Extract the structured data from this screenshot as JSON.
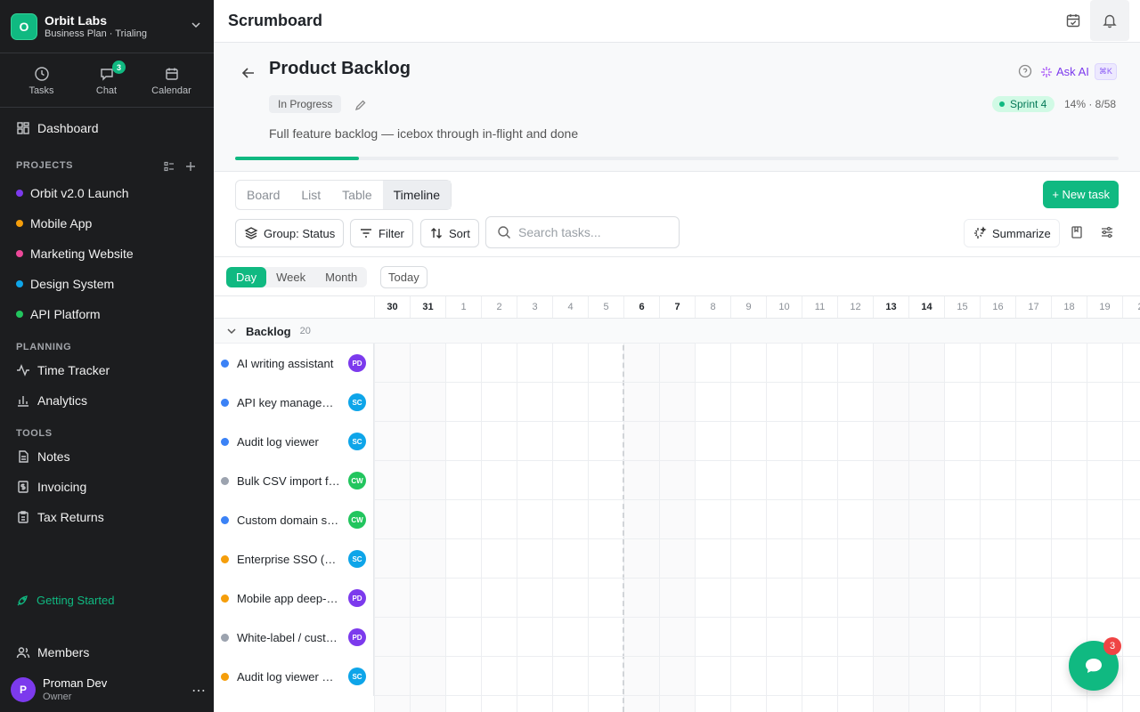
{
  "org": {
    "initial": "O",
    "name": "Orbit Labs",
    "plan": "Business Plan · Trialing"
  },
  "quick": [
    {
      "label": "Tasks",
      "icon": "clock-icon"
    },
    {
      "label": "Chat",
      "icon": "chat-icon",
      "badge": "3"
    },
    {
      "label": "Calendar",
      "icon": "calendar-icon"
    }
  ],
  "nav": {
    "dashboard": "Dashboard"
  },
  "projects": {
    "heading": "PROJECTS",
    "items": [
      {
        "label": "Orbit v2.0 Launch",
        "color": "#7c3aed"
      },
      {
        "label": "Mobile App",
        "color": "#f59e0b"
      },
      {
        "label": "Marketing Website",
        "color": "#ec4899"
      },
      {
        "label": "Design System",
        "color": "#0ea5e9"
      },
      {
        "label": "API Platform",
        "color": "#22c55e"
      }
    ]
  },
  "planning": {
    "heading": "PLANNING",
    "items": [
      "Time Tracker",
      "Analytics"
    ]
  },
  "tools": {
    "heading": "TOOLS",
    "items": [
      "Notes",
      "Invoicing",
      "Tax Returns"
    ]
  },
  "getting_started": "Getting Started",
  "members": "Members",
  "user": {
    "initial": "P",
    "name": "Proman Dev",
    "role": "Owner"
  },
  "topbar": {
    "title": "Scrumboard"
  },
  "header": {
    "title": "Product Backlog",
    "status": "In Progress",
    "description": "Full feature backlog — icebox through in-flight and done",
    "ask_ai": "Ask AI",
    "shortcut": "⌘K",
    "sprint": "Sprint 4",
    "progress_text": "14% · 8/58",
    "progress_fraction": 0.14
  },
  "views": {
    "tabs": [
      "Board",
      "List",
      "Table",
      "Timeline"
    ],
    "active": "Timeline"
  },
  "new_task": "+ New task",
  "toolbar": {
    "group": "Group: Status",
    "filter": "Filter",
    "sort": "Sort",
    "search_placeholder": "Search tasks...",
    "summarize": "Summarize"
  },
  "timeline": {
    "scales": [
      "Day",
      "Week",
      "Month"
    ],
    "active_scale": "Day",
    "today": "Today",
    "dates": [
      "30",
      "31",
      "1",
      "2",
      "3",
      "4",
      "5",
      "6",
      "7",
      "8",
      "9",
      "10",
      "11",
      "12",
      "13",
      "14",
      "15",
      "16",
      "17",
      "18",
      "19",
      "2"
    ],
    "bold_dates": [
      "30",
      "31",
      "6",
      "7",
      "13",
      "14"
    ],
    "group": {
      "label": "Backlog",
      "count": "20"
    },
    "tasks": [
      {
        "name": "AI writing assistant",
        "dot": "#3b82f6",
        "assignee": "PD",
        "avatar": "#7c3aed"
      },
      {
        "name": "API key management",
        "dot": "#3b82f6",
        "assignee": "SC",
        "avatar": "#0ea5e9"
      },
      {
        "name": "Audit log viewer",
        "dot": "#3b82f6",
        "assignee": "SC",
        "avatar": "#0ea5e9"
      },
      {
        "name": "Bulk CSV import flow",
        "dot": "#9ca3af",
        "assignee": "CW",
        "avatar": "#22c55e"
      },
      {
        "name": "Custom domain support",
        "dot": "#3b82f6",
        "assignee": "CW",
        "avatar": "#22c55e"
      },
      {
        "name": "Enterprise SSO (SAML)",
        "dot": "#f59e0b",
        "assignee": "SC",
        "avatar": "#0ea5e9"
      },
      {
        "name": "Mobile app deep-linking",
        "dot": "#f59e0b",
        "assignee": "PD",
        "avatar": "#7c3aed"
      },
      {
        "name": "White-label / custom branding",
        "dot": "#9ca3af",
        "assignee": "PD",
        "avatar": "#7c3aed"
      },
      {
        "name": "Audit log viewer with filters",
        "dot": "#f59e0b",
        "assignee": "SC",
        "avatar": "#0ea5e9"
      }
    ]
  },
  "chat_fab": {
    "badge": "3"
  },
  "colors": {
    "accent": "#10b981",
    "sidebar": "#1c1d1f"
  }
}
